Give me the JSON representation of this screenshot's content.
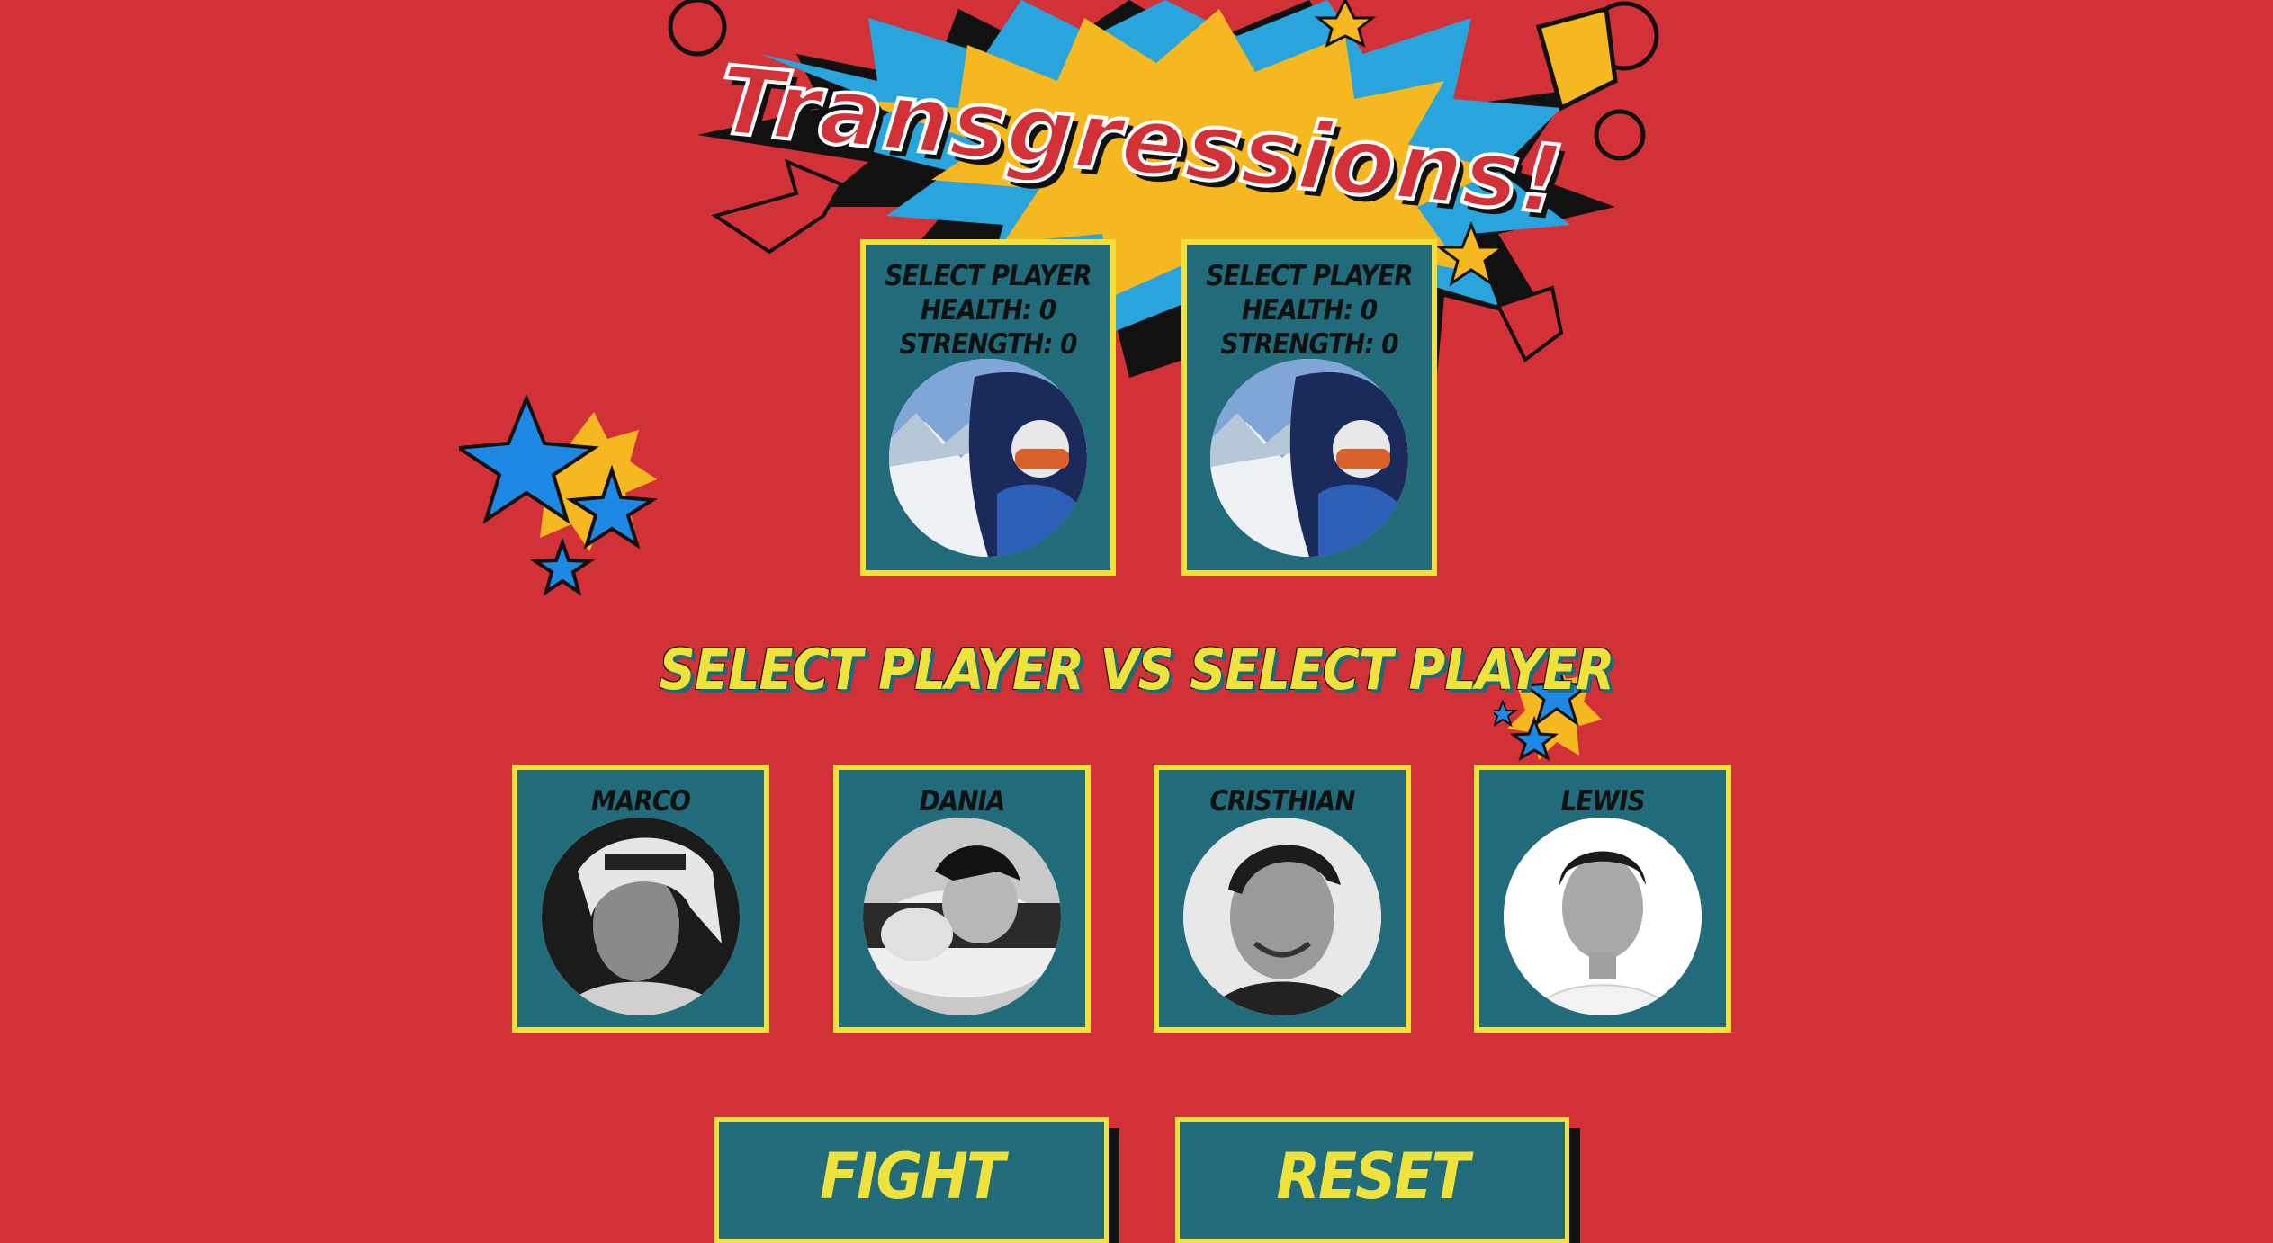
{
  "app": {
    "title": "Transgressions!"
  },
  "arena": {
    "slot_1": {
      "name": "Select Player",
      "health_line": "Health: 0",
      "strength_line": "Strength: 0"
    },
    "slot_2": {
      "name": "Select Player",
      "health_line": "Health: 0",
      "strength_line": "Strength: 0"
    },
    "vs_line": "Select Player vs Select Player"
  },
  "roster": [
    {
      "name": "Marco"
    },
    {
      "name": "Dania"
    },
    {
      "name": "Cristhian"
    },
    {
      "name": "Lewis"
    }
  ],
  "controls": {
    "fight_label": "Fight",
    "reset_label": "Reset"
  },
  "colors": {
    "background": "#d33138",
    "card": "#216b7a",
    "card_border": "#f3e03b",
    "button_text": "#f0e23c",
    "star_blue": "#1e88e5",
    "star_yellow": "#f6b820"
  },
  "icons": [
    "starburst-logo",
    "stars-decoration",
    "player-portrait"
  ]
}
